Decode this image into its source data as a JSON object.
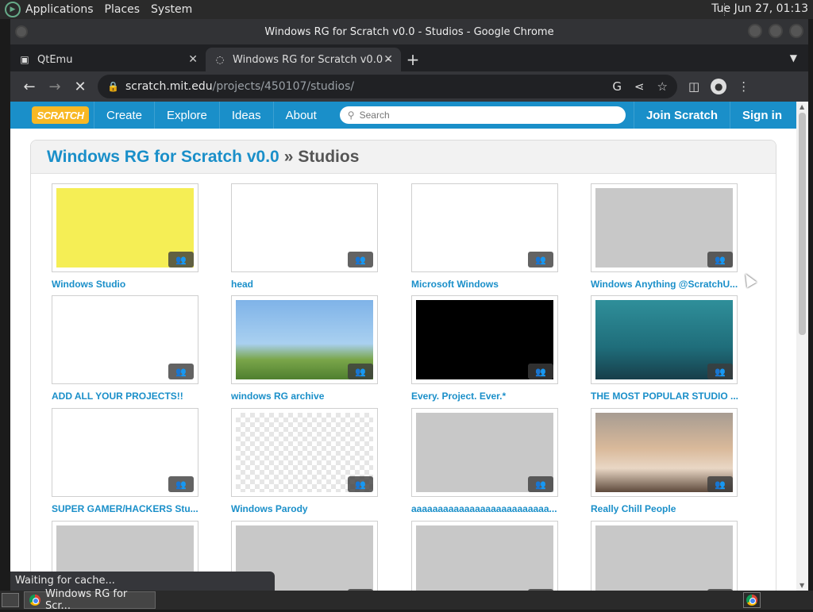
{
  "desktop": {
    "menus": [
      "Applications",
      "Places",
      "System"
    ],
    "clock": "Tue Jun 27, 01:13",
    "taskbar_task": "Windows RG for Scr..."
  },
  "window": {
    "title": "Windows RG for Scratch v0.0 - Studios - Google Chrome"
  },
  "tabs": [
    {
      "label": "QtEmu",
      "close": "✕"
    },
    {
      "label": "Windows RG for Scratch v0.0 -",
      "close": "✕"
    }
  ],
  "new_tab": "+",
  "address": {
    "host": "scratch.mit.edu",
    "path": "/projects/450107/studios/"
  },
  "scratch_nav": {
    "logo": "SCRATCH",
    "links": [
      "Create",
      "Explore",
      "Ideas",
      "About"
    ],
    "search_placeholder": "Search",
    "join": "Join Scratch",
    "signin": "Sign in"
  },
  "header": {
    "project": "Windows RG for Scratch v0.0",
    "separator": "»",
    "section": "Studios"
  },
  "studios": [
    {
      "title": "Windows Studio",
      "thumb": "yellow"
    },
    {
      "title": "head",
      "thumb": "white"
    },
    {
      "title": "Microsoft Windows",
      "thumb": "white"
    },
    {
      "title": "Windows Anything @ScratchU...",
      "thumb": "gray"
    },
    {
      "title": "ADD ALL YOUR PROJECTS!!",
      "thumb": "white"
    },
    {
      "title": "windows RG archive",
      "thumb": "sky"
    },
    {
      "title": "Every. Project. Ever.*",
      "thumb": "black"
    },
    {
      "title": "THE MOST POPULAR STUDIO ...",
      "thumb": "teal"
    },
    {
      "title": "SUPER GAMER/HACKERS Stu...",
      "thumb": "white"
    },
    {
      "title": "Windows Parody",
      "thumb": "checker"
    },
    {
      "title": "aaaaaaaaaaaaaaaaaaaaaaaaaa...",
      "thumb": "gray"
    },
    {
      "title": "Really Chill People",
      "thumb": "sunset"
    },
    {
      "title": "",
      "thumb": "gray"
    },
    {
      "title": "",
      "thumb": "gray"
    },
    {
      "title": "",
      "thumb": "gray"
    },
    {
      "title": "",
      "thumb": "gray"
    }
  ],
  "status": "Waiting for cache...",
  "colors": {
    "scratch_blue": "#1a8fc9",
    "scratch_orange": "#f8b824"
  },
  "icons": {
    "studio_badge": "group-icon",
    "reload": "stop-loading-icon"
  }
}
